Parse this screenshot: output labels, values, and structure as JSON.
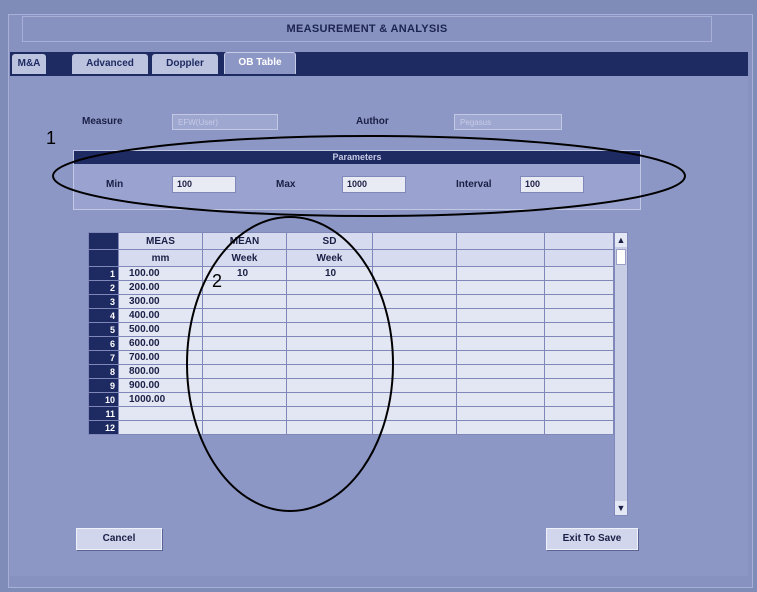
{
  "title": "MEASUREMENT & ANALYSIS",
  "tabs": [
    {
      "label": "M&A"
    },
    {
      "label": "Advanced"
    },
    {
      "label": "Doppler"
    },
    {
      "label": "OB Table"
    }
  ],
  "form": {
    "measure_label": "Measure",
    "measure_value": "EFW(User)",
    "author_label": "Author",
    "author_value": "Pegasus"
  },
  "parameters": {
    "header": "Parameters",
    "min_label": "Min",
    "min_value": "100",
    "max_label": "Max",
    "max_value": "1000",
    "interval_label": "Interval",
    "interval_value": "100"
  },
  "table": {
    "headers1": [
      "MEAS",
      "MEAN",
      "SD",
      "",
      "",
      ""
    ],
    "headers2": [
      "mm",
      "Week",
      "Week",
      "",
      "",
      ""
    ],
    "rows": [
      {
        "n": "1",
        "meas": "100.00",
        "mean": "10",
        "sd": "10"
      },
      {
        "n": "2",
        "meas": "200.00",
        "mean": "",
        "sd": ""
      },
      {
        "n": "3",
        "meas": "300.00",
        "mean": "",
        "sd": ""
      },
      {
        "n": "4",
        "meas": "400.00",
        "mean": "",
        "sd": ""
      },
      {
        "n": "5",
        "meas": "500.00",
        "mean": "",
        "sd": ""
      },
      {
        "n": "6",
        "meas": "600.00",
        "mean": "",
        "sd": ""
      },
      {
        "n": "7",
        "meas": "700.00",
        "mean": "",
        "sd": ""
      },
      {
        "n": "8",
        "meas": "800.00",
        "mean": "",
        "sd": ""
      },
      {
        "n": "9",
        "meas": "900.00",
        "mean": "",
        "sd": ""
      },
      {
        "n": "10",
        "meas": "1000.00",
        "mean": "",
        "sd": ""
      },
      {
        "n": "11",
        "meas": "",
        "mean": "",
        "sd": ""
      },
      {
        "n": "12",
        "meas": "",
        "mean": "",
        "sd": ""
      }
    ]
  },
  "buttons": {
    "cancel": "Cancel",
    "exit_save": "Exit To Save"
  },
  "annotations": {
    "one": "1",
    "two": "2"
  },
  "icons": {
    "scroll_up": "triangle-up",
    "scroll_down": "triangle-down"
  }
}
